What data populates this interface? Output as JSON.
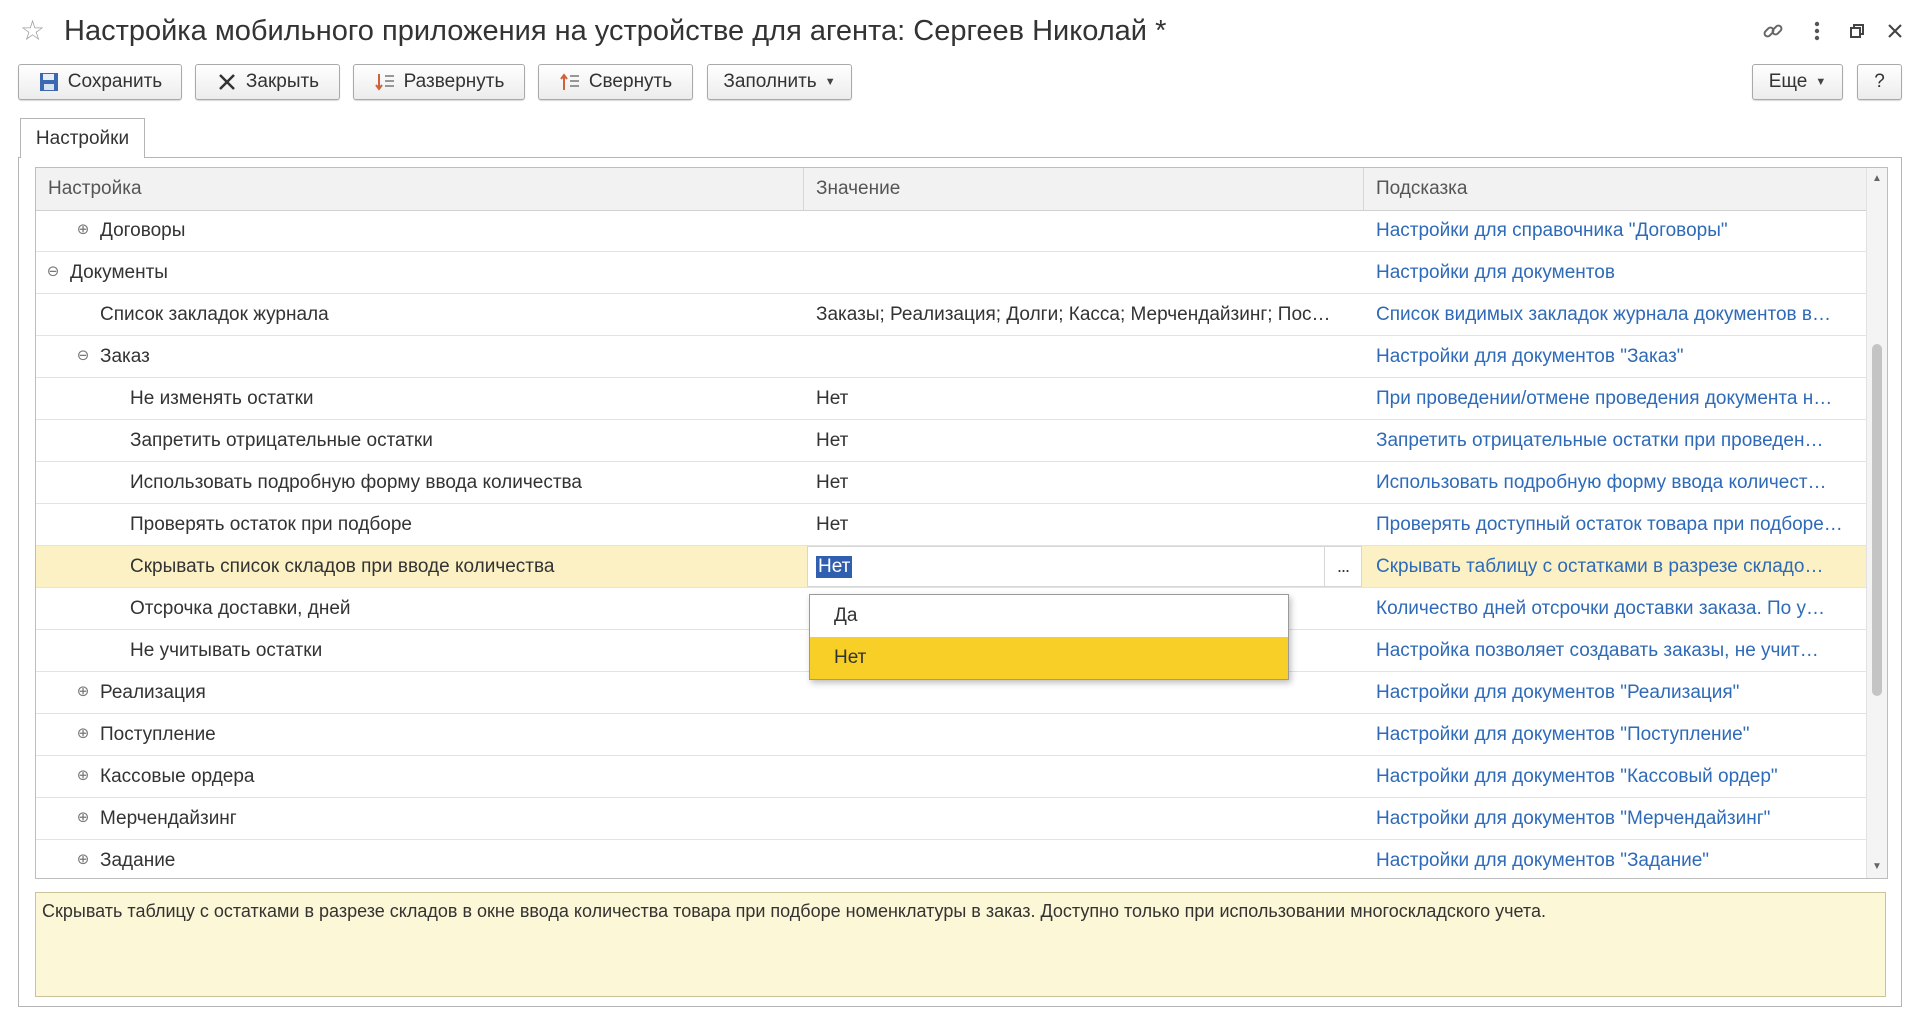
{
  "window": {
    "title": "Настройка мобильного приложения на устройстве для агента: Сергеев Николай *"
  },
  "toolbar": {
    "save": "Сохранить",
    "close": "Закрыть",
    "expand": "Развернуть",
    "collapse": "Свернуть",
    "fill": "Заполнить",
    "more": "Еще",
    "help": "?"
  },
  "tabs": [
    {
      "label": "Настройки"
    }
  ],
  "grid": {
    "columns": [
      "Настройка",
      "Значение",
      "Подсказка"
    ],
    "rows": [
      {
        "label": "Договоры",
        "level": 1,
        "toggle": "plus",
        "value": "",
        "hint": "Настройки для справочника \"Договоры\""
      },
      {
        "label": "Документы",
        "level": 0,
        "toggle": "minus",
        "value": "",
        "hint": "Настройки для документов"
      },
      {
        "label": "Список закладок журнала",
        "level": 1,
        "toggle": "",
        "value": "Заказы; Реализация; Долги; Касса; Мерчендайзинг; Пос…",
        "hint": "Список видимых закладок журнала документов в…"
      },
      {
        "label": "Заказ",
        "level": 1,
        "toggle": "minus",
        "value": "",
        "hint": "Настройки для документов \"Заказ\""
      },
      {
        "label": "Не изменять остатки",
        "level": 2,
        "toggle": "",
        "value": "Нет",
        "hint": "При проведении/отмене проведения документа н…"
      },
      {
        "label": "Запретить отрицательные остатки",
        "level": 2,
        "toggle": "",
        "value": "Нет",
        "hint": "Запретить отрицательные остатки при проведен…"
      },
      {
        "label": "Использовать подробную форму ввода количества",
        "level": 2,
        "toggle": "",
        "value": "Нет",
        "hint": "Использовать подробную форму ввода количест…"
      },
      {
        "label": "Проверять остаток при подборе",
        "level": 2,
        "toggle": "",
        "value": "Нет",
        "hint": "Проверять доступный остаток товара при подборе…"
      },
      {
        "label": "Скрывать список складов при вводе количества",
        "level": 2,
        "toggle": "",
        "value": "Нет",
        "hint": "Скрывать таблицу с остатками в разрезе складо…",
        "selected": true
      },
      {
        "label": "Отсрочка доставки, дней",
        "level": 2,
        "toggle": "",
        "value": "",
        "hint": "Количество дней отсрочки доставки заказа. По у…"
      },
      {
        "label": "Не учитывать остатки",
        "level": 2,
        "toggle": "",
        "value": "",
        "hint": "Настройка позволяет создавать заказы, не учит…"
      },
      {
        "label": "Реализация",
        "level": 1,
        "toggle": "plus",
        "value": "",
        "hint": "Настройки для документов \"Реализация\""
      },
      {
        "label": "Поступление",
        "level": 1,
        "toggle": "plus",
        "value": "",
        "hint": "Настройки для документов \"Поступление\""
      },
      {
        "label": "Кассовые ордера",
        "level": 1,
        "toggle": "plus",
        "value": "",
        "hint": "Настройки для документов \"Кассовый ордер\""
      },
      {
        "label": "Мерчендайзинг",
        "level": 1,
        "toggle": "plus",
        "value": "",
        "hint": "Настройки для документов \"Мерчендайзинг\""
      },
      {
        "label": "Задание",
        "level": 1,
        "toggle": "plus",
        "value": "",
        "hint": "Настройки для документов \"Задание\""
      }
    ]
  },
  "editor": {
    "value": "Нет",
    "button": "..."
  },
  "dropdown": {
    "options": [
      "Да",
      "Нет"
    ],
    "selected_index": 1
  },
  "hint_text": "Скрывать таблицу с остатками в разрезе складов в окне ввода количества товара при подборе номенклатуры в заказ. Доступно только при использовании многоскладского учета.",
  "icons": {
    "star": "favorite-star-icon",
    "link": "link-icon",
    "menu": "more-vertical-icon",
    "restore": "restore-window-icon",
    "close": "close-window-icon"
  }
}
